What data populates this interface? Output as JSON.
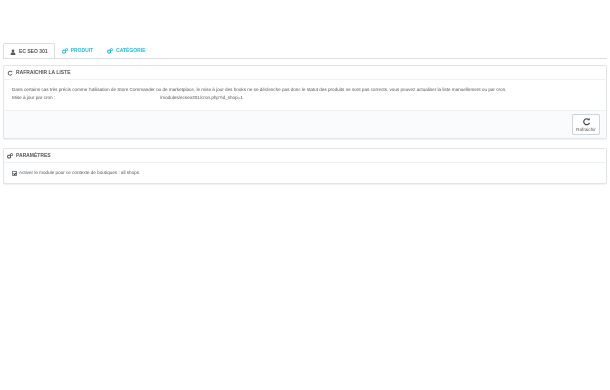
{
  "tabs": [
    {
      "label": "EC SEO 301",
      "icon": "user-icon",
      "active": true
    },
    {
      "label": "PRODUIT",
      "icon": "cogs-icon",
      "active": false
    },
    {
      "label": "CATÉGORIE",
      "icon": "cogs-icon",
      "active": false
    }
  ],
  "refresh_panel": {
    "title": "RAFRAICHIR LA LISTE",
    "icon": "refresh-icon",
    "description": "Dans certains cas très précis comme l'utilisation de Store Commander ou de marketplace, le mise à jour des hooks ne se déclenche pas donc le statut des produits ne sont pas corrects, vous pouvez actualiser la liste manuellement ou par cron.",
    "cron_label": "Mise à jour par cron :",
    "cron_url": "/modules/ecseo301/cron.php?id_shop=1",
    "button_label": "Rafraichir"
  },
  "params_panel": {
    "title": "PARAMÈTRES",
    "icon": "cogs-icon",
    "checkbox_label": "Activer le module pour ce contexte de boutiques : all shops.",
    "checkbox_checked": true
  },
  "colors": {
    "accent": "#25b9d7",
    "text": "#555555",
    "border": "#e1e5e8"
  }
}
